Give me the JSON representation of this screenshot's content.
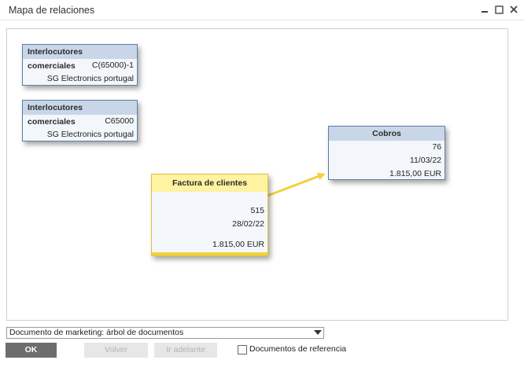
{
  "window": {
    "title": "Mapa de relaciones",
    "minimize_icon": "minimize-icon",
    "maximize_icon": "maximize-icon",
    "close_icon": "close-icon"
  },
  "nodes": {
    "bp1": {
      "header": "Interlocutores comerciales",
      "code": "C(65000)-1",
      "name": "SG Electronics portugal"
    },
    "bp2": {
      "header": "Interlocutores comerciales",
      "code": "C65000",
      "name": "SG Electronics portugal"
    },
    "invoice": {
      "header": "Factura de clientes",
      "number": "515",
      "date": "28/02/22",
      "amount": "1.815,00 EUR"
    },
    "payment": {
      "header": "Cobros",
      "number": "76",
      "date": "11/03/22",
      "amount": "1.815,00 EUR"
    }
  },
  "colors": {
    "arrow": "#f1d23f",
    "node_border": "#5b7ea8",
    "node_header": "#c9d6e7",
    "invoice_header": "#fff2a0"
  },
  "footer": {
    "dropdown_value": "Documento de marketing: árbol de documentos",
    "ok_label": "OK",
    "back_label": "Volver",
    "forward_label": "Ir adelante",
    "reference_docs_label": "Documentos de referencia",
    "reference_docs_checked": false
  }
}
